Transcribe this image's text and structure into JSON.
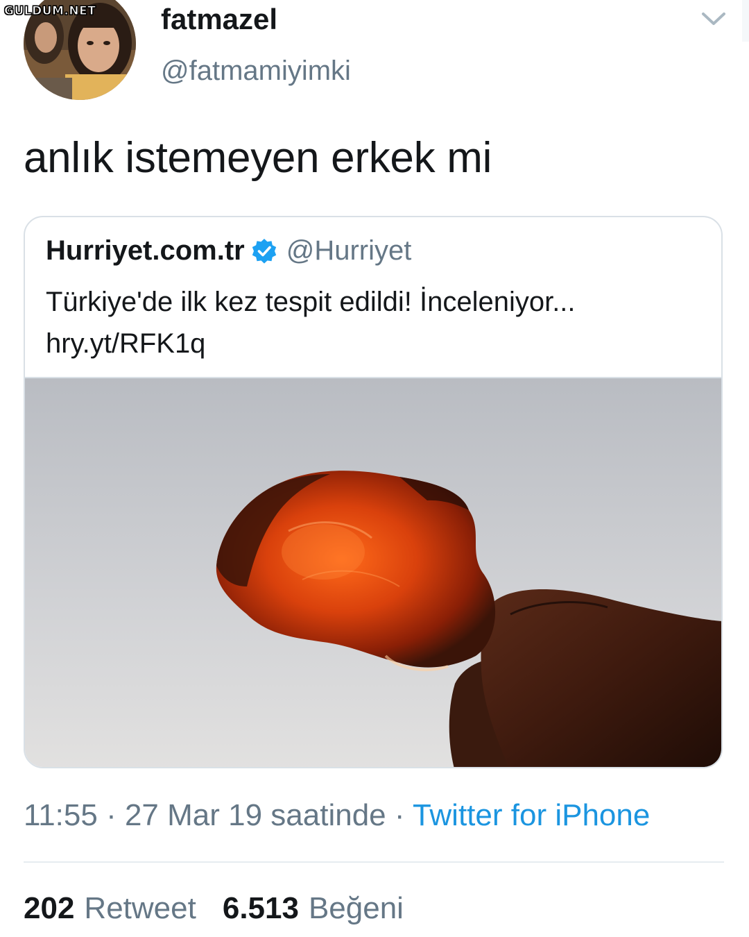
{
  "watermark": "GULDUM.NET",
  "author": {
    "display_name": "fatmazel",
    "handle": "@fatmamiyimki",
    "avatar_icon": "profile-photo"
  },
  "menu_icon": "chevron-down-icon",
  "tweet": {
    "text": "anlık istemeyen erkek mi"
  },
  "quoted_tweet": {
    "display_name": "Hurriyet.com.tr",
    "verified_icon": "verified-badge-icon",
    "handle": "@Hurriyet",
    "text_line1": "Türkiye'de ilk kez tespit edildi! İnceleniyor...",
    "text_line2": "hry.yt/RFK1q",
    "image": "amber-stone-held-between-fingers"
  },
  "meta": {
    "time": "11:55",
    "sep1": " · ",
    "date": "27 Mar 19 saatinde",
    "sep2": " · ",
    "source": "Twitter for iPhone"
  },
  "stats": {
    "retweets_count": "202",
    "retweets_label": "Retweet",
    "likes_count": "6.513",
    "likes_label": "Beğeni"
  },
  "colors": {
    "link_blue": "#1b95e0",
    "secondary_gray": "#657786",
    "border": "#d9e0e6"
  }
}
